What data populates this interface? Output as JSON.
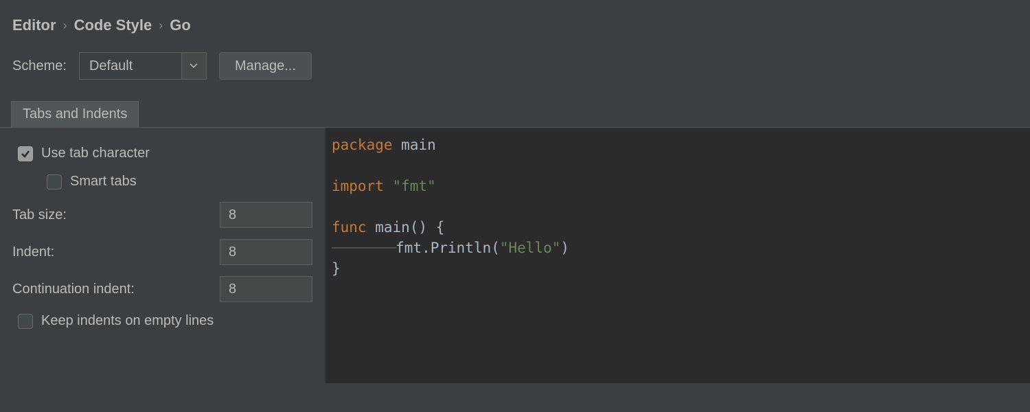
{
  "breadcrumb": {
    "items": [
      "Editor",
      "Code Style",
      "Go"
    ],
    "sep": "›"
  },
  "scheme": {
    "label": "Scheme:",
    "value": "Default",
    "manage_label": "Manage..."
  },
  "tabs": [
    {
      "label": "Tabs and Indents"
    }
  ],
  "settings": {
    "use_tab_label": "Use tab character",
    "use_tab_checked": true,
    "smart_tabs_label": "Smart tabs",
    "smart_tabs_checked": false,
    "tab_size_label": "Tab size:",
    "tab_size_value": "8",
    "indent_label": "Indent:",
    "indent_value": "8",
    "cont_indent_label": "Continuation indent:",
    "cont_indent_value": "8",
    "keep_indents_label": "Keep indents on empty lines",
    "keep_indents_checked": false
  },
  "code": {
    "kw_package": "package",
    "pkg_name": "main",
    "kw_import": "import",
    "import_path": "\"fmt\"",
    "kw_func": "func",
    "func_name": "main",
    "parens_open": "()",
    "brace_open": "{",
    "indent_ws": "────────",
    "call": "fmt.Println(",
    "call_arg": "\"Hello\"",
    "call_close": ")",
    "brace_close": "}"
  }
}
